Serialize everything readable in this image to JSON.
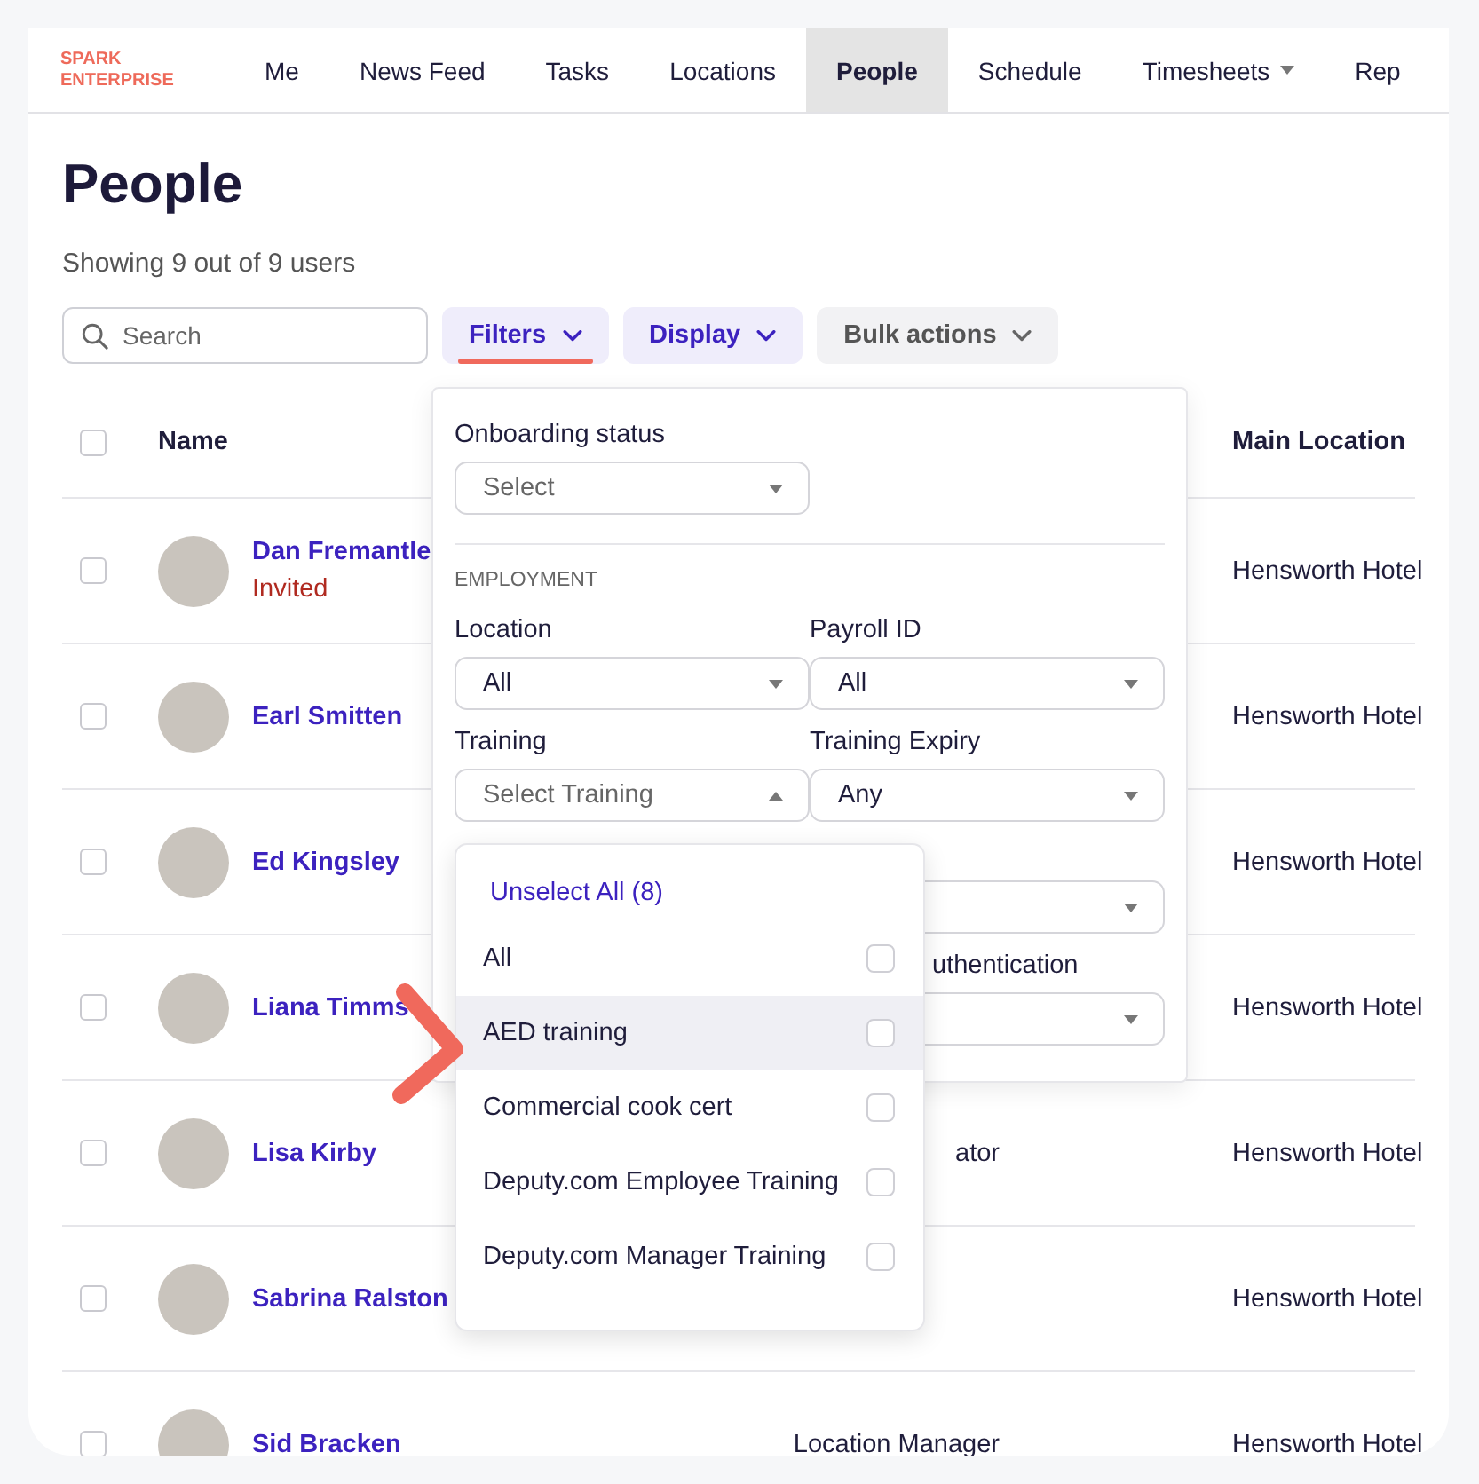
{
  "nav": {
    "logo": "SPARK ENTERPRISE",
    "items": [
      {
        "label": "Me",
        "selected": false,
        "has_menu": false
      },
      {
        "label": "News Feed",
        "selected": false,
        "has_menu": false
      },
      {
        "label": "Tasks",
        "selected": false,
        "has_menu": false
      },
      {
        "label": "Locations",
        "selected": false,
        "has_menu": false
      },
      {
        "label": "People",
        "selected": true,
        "has_menu": false
      },
      {
        "label": "Schedule",
        "selected": false,
        "has_menu": false
      },
      {
        "label": "Timesheets",
        "selected": false,
        "has_menu": true
      },
      {
        "label": "Rep",
        "selected": false,
        "has_menu": false
      }
    ]
  },
  "page": {
    "title": "People",
    "subtitle": "Showing 9 out of 9 users"
  },
  "toolbar": {
    "search": {
      "placeholder": "Search"
    },
    "buttons": [
      {
        "label": "Filters",
        "kind": "accent",
        "underlined": true
      },
      {
        "label": "Display",
        "kind": "accent",
        "underlined": false
      },
      {
        "label": "Bulk actions",
        "kind": "plain",
        "underlined": false
      }
    ]
  },
  "table": {
    "all_checked": false,
    "columns": [
      {
        "label": "Name"
      },
      {
        "label": "Main Location"
      }
    ],
    "rows": [
      {
        "name": "Dan Fremantle",
        "status": "Invited",
        "location": "Hensworth Hotel",
        "checked": false
      },
      {
        "name": "Earl Smitten",
        "location": "Hensworth Hotel",
        "checked": false
      },
      {
        "name": "Ed Kingsley",
        "location": "Hensworth Hotel",
        "checked": false
      },
      {
        "name": "Liana Timms",
        "location": "Hensworth Hotel",
        "checked": false
      },
      {
        "name": "Lisa Kirby",
        "role": "ator",
        "location": "Hensworth Hotel",
        "checked": false
      },
      {
        "name": "Sabrina Ralston",
        "location": "Hensworth Hotel",
        "checked": false
      },
      {
        "name": "Sid Bracken",
        "role": "Location Manager",
        "location": "Hensworth Hotel",
        "checked": false
      }
    ]
  },
  "filter_panel": {
    "onboarding": {
      "label": "Onboarding status",
      "placeholder": "Select"
    },
    "section": "EMPLOYMENT",
    "fields": [
      {
        "kind": "select",
        "label": "Location",
        "value": "All",
        "expanded": false
      },
      {
        "kind": "select",
        "label": "Payroll ID",
        "value": "All",
        "expanded": false
      },
      {
        "kind": "select",
        "label": "Training",
        "placeholder": "Select Training",
        "expanded": true
      },
      {
        "kind": "select",
        "label": "Training Expiry",
        "value": "Any",
        "expanded": false
      },
      {
        "kind": "hidden"
      },
      {
        "kind": "select",
        "expanded": false
      },
      {
        "kind": "hidden"
      },
      {
        "kind": "partial",
        "label": "uthentication",
        "expanded": false
      }
    ]
  },
  "training_dropdown": {
    "action": "Unselect All (8)",
    "options": [
      {
        "label": "All",
        "checked": false,
        "highlighted": false,
        "pointed": false
      },
      {
        "label": "AED training",
        "checked": false,
        "highlighted": true,
        "pointed": true
      },
      {
        "label": "Commercial cook cert",
        "checked": false,
        "highlighted": false,
        "pointed": false
      },
      {
        "label": "Deputy.com Employee Training",
        "checked": false,
        "highlighted": false,
        "pointed": false
      },
      {
        "label": "Deputy.com Manager Training",
        "checked": false,
        "highlighted": false,
        "pointed": false
      }
    ]
  }
}
